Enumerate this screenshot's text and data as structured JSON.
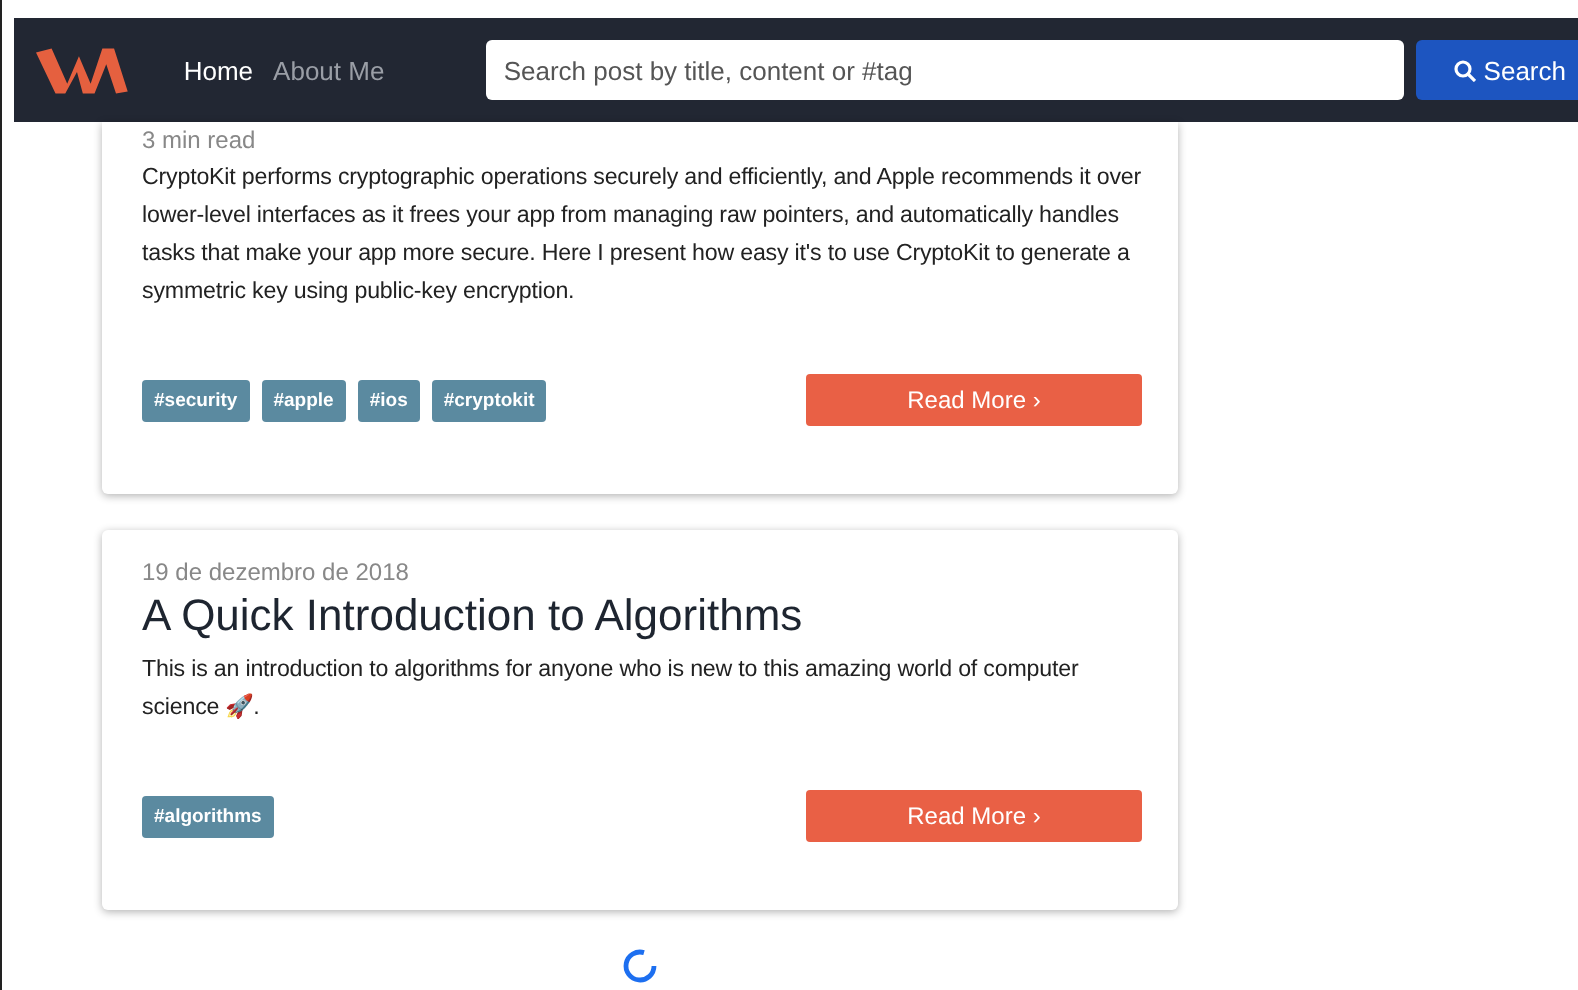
{
  "navbar": {
    "links": [
      {
        "label": "Home",
        "selected": true
      },
      {
        "label": "About Me",
        "selected": false
      }
    ],
    "search": {
      "placeholder": "Search post by title, content or #tag",
      "button": "Search"
    }
  },
  "posts": [
    {
      "meta": "3 min read",
      "summary": "CryptoKit performs cryptographic operations securely and efficiently, and Apple recommends it over lower-level interfaces as it frees your app from managing raw pointers, and automatically handles tasks that make your app more secure. Here I present how easy it's to use CryptoKit to generate a symmetric key using public-key encryption.",
      "tags": [
        "#security",
        "#apple",
        "#ios",
        "#cryptokit"
      ],
      "button": "Read More ›"
    },
    {
      "meta": "19 de dezembro de 2018",
      "title": "A Quick Introduction to Algorithms",
      "summary": "This is an introduction to algorithms for anyone who is new to this amazing world of computer science 🚀.",
      "tags": [
        "#algorithms"
      ],
      "button": "Read More ›"
    }
  ],
  "loading": true
}
